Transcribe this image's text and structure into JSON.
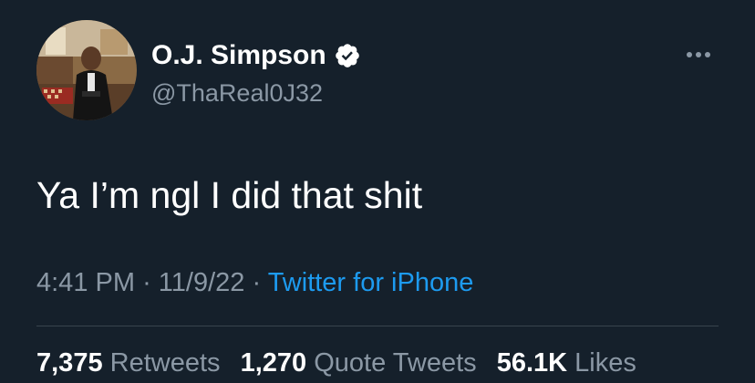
{
  "author": {
    "display_name": "O.J. Simpson",
    "handle": "@ThaReal0J32",
    "verified_icon": "verified-badge-icon",
    "avatar": "profile-photo"
  },
  "tweet": {
    "text": "Ya I’m ngl I did that shit"
  },
  "meta": {
    "time": "4:41 PM",
    "separator": "·",
    "date": "11/9/22",
    "source": "Twitter for iPhone"
  },
  "stats": {
    "retweets_count": "7,375",
    "retweets_label": "Retweets",
    "quotes_count": "1,270",
    "quotes_label": "Quote Tweets",
    "likes_count": "56.1K",
    "likes_label": "Likes"
  },
  "colors": {
    "background": "#15202b",
    "primary_text": "#ffffff",
    "secondary_text": "#8b98a5",
    "link": "#1d9bf0",
    "divider": "#38444d"
  }
}
